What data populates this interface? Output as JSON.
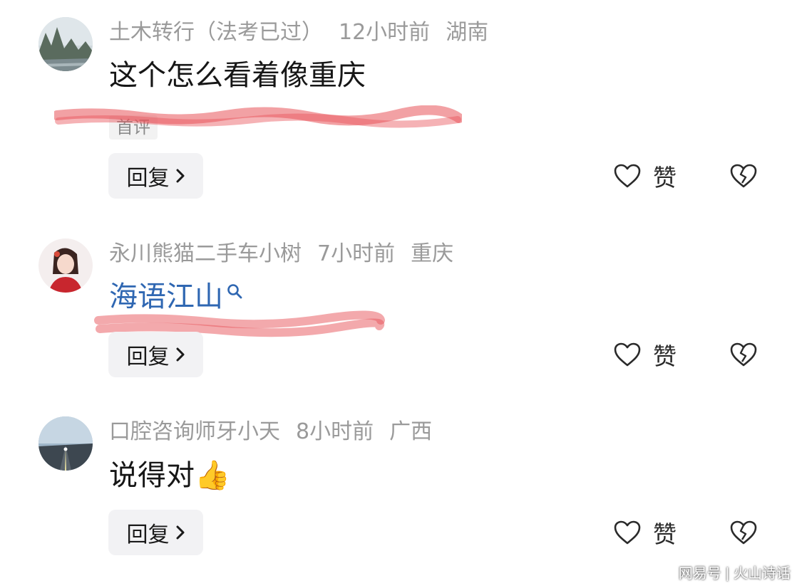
{
  "comments": [
    {
      "username": "土木转行（法考已过）",
      "time": "12小时前",
      "location": "湖南",
      "text": "这个怎么看着像重庆",
      "tag": "首评",
      "reply_label": "回复",
      "like_label": "赞",
      "avatar": "mountain-landscape"
    },
    {
      "username": "永川熊猫二手车小树",
      "time": "7小时前",
      "location": "重庆",
      "text": "海语江山",
      "reply_label": "回复",
      "like_label": "赞",
      "avatar": "anime-character"
    },
    {
      "username": "口腔咨询师牙小天",
      "time": "8小时前",
      "location": "广西",
      "text": "说得对",
      "emoji": "👍",
      "reply_label": "回复",
      "like_label": "赞",
      "avatar": "road-landscape"
    }
  ],
  "watermark": {
    "left": "网易号",
    "right": "火山诗话"
  },
  "colors": {
    "meta": "#9a9a9a",
    "link": "#2f67b2",
    "reply_bg": "#f2f2f4",
    "scribble": "#e8545a"
  },
  "icons": [
    "heart-outline-icon",
    "broken-heart-icon",
    "chevron-right-icon",
    "search-icon"
  ]
}
